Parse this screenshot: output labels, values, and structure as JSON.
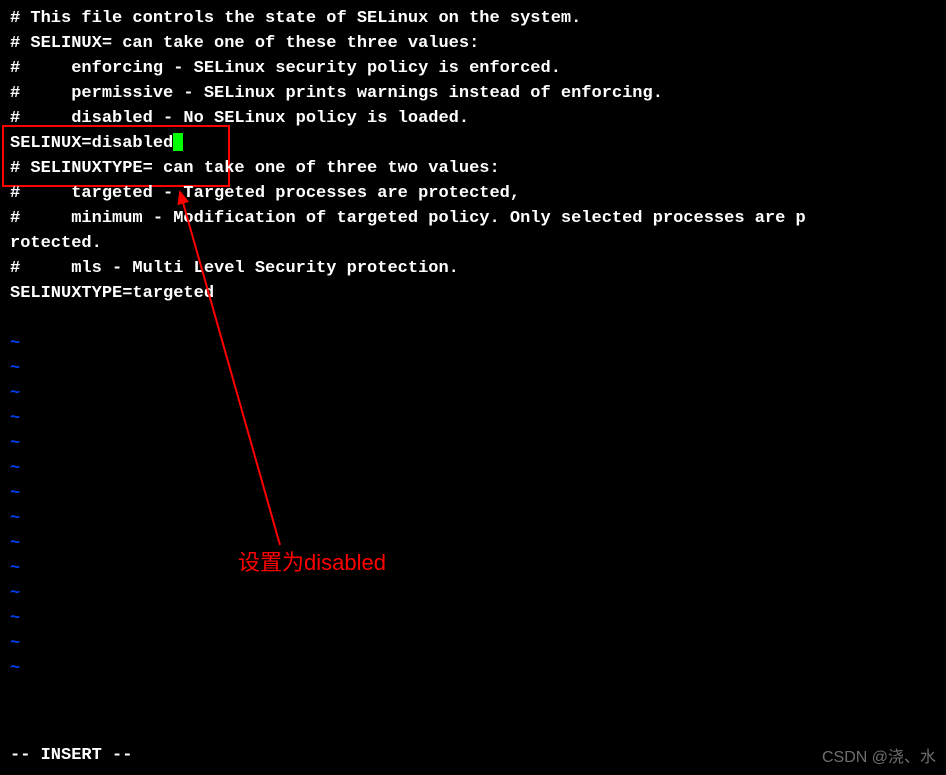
{
  "file": {
    "lines": [
      "# This file controls the state of SELinux on the system.",
      "# SELINUX= can take one of these three values:",
      "#     enforcing - SELinux security policy is enforced.",
      "#     permissive - SELinux prints warnings instead of enforcing.",
      "#     disabled - No SELinux policy is loaded.",
      "SELINUX=disabled",
      "# SELINUXTYPE= can take one of three two values:",
      "#     targeted - Targeted processes are protected,",
      "#     minimum - Modification of targeted policy. Only selected processes are p",
      "rotected.",
      "#     mls - Multi Level Security protection.",
      "SELINUXTYPE=targeted",
      " "
    ],
    "cursor_line_index": 5
  },
  "tildes_count": 14,
  "status": "-- INSERT --",
  "annotation": "设置为disabled",
  "watermark": "CSDN @浇、水"
}
